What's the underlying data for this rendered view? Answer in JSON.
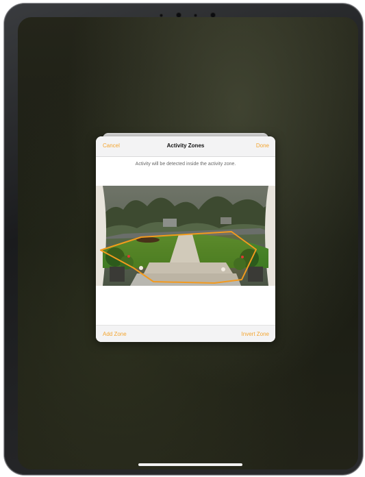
{
  "dialog": {
    "cancel_label": "Cancel",
    "title": "Activity Zones",
    "done_label": "Done",
    "description": "Activity will be detected inside the activity zone.",
    "add_zone_label": "Add Zone",
    "invert_zone_label": "Invert Zone"
  },
  "colors": {
    "accent": "#f3a530",
    "zone_outline": "#f39a1e"
  },
  "icons": {
    "camera": "front-camera-icon"
  }
}
